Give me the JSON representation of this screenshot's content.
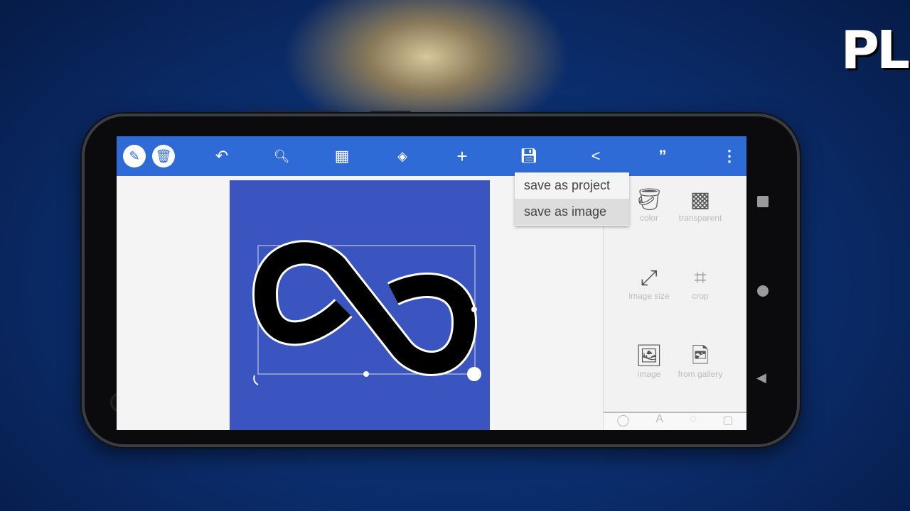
{
  "brand": {
    "logo_text": "PL"
  },
  "toolbar": {
    "icons": [
      "pencil-icon",
      "trash-icon",
      "undo-icon",
      "zoom-icon",
      "grid-icon",
      "layers-icon",
      "add-icon",
      "save-icon",
      "share-icon",
      "quote-icon",
      "more-icon"
    ]
  },
  "save_menu": {
    "items": [
      "save as project",
      "save as image"
    ]
  },
  "panel": {
    "tools": [
      {
        "label": "color"
      },
      {
        "label": "transparent"
      },
      {
        "label": "image size"
      },
      {
        "label": "crop"
      },
      {
        "label": "image"
      },
      {
        "label": "from gallery"
      }
    ]
  },
  "colors": {
    "toolbar": "#2f6bd6",
    "canvas": "#3a55bf"
  }
}
